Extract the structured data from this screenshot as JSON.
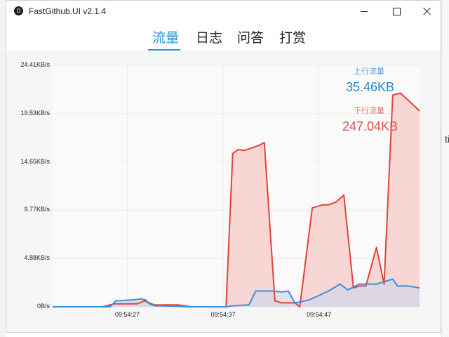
{
  "window": {
    "title": "FastGithub.UI v2.1.4",
    "controls": {
      "minimize": "minimize",
      "maximize": "maximize",
      "close": "close"
    }
  },
  "tabs": [
    {
      "label": "流量",
      "active": true
    },
    {
      "label": "日志",
      "active": false
    },
    {
      "label": "问答",
      "active": false
    },
    {
      "label": "打赏",
      "active": false
    }
  ],
  "background_window": {
    "clipped_text": "ti"
  },
  "legend": {
    "upload_label": "上行流量",
    "upload_value": "35.46KB",
    "download_label": "下行流量",
    "download_value": "247.04KB"
  },
  "colors": {
    "accent": "#2196d3",
    "upload_line": "#3b8fdb",
    "download_line": "#e0443a",
    "download_fill": "#f7cfcb",
    "upload_fill": "#d7d6ea"
  },
  "chart_data": {
    "type": "area",
    "y_ticks": [
      "24.41KB/s",
      "19.53KB/s",
      "14.65KB/s",
      "9.77KB/s",
      "4.88KB/s",
      "0B/s"
    ],
    "y_tick_values": [
      24.41,
      19.53,
      14.65,
      9.77,
      4.88,
      0
    ],
    "ylim": [
      0,
      24.41
    ],
    "x_ticks": [
      "09:54:27",
      "09:54:37",
      "09:54:47"
    ],
    "x_tick_values": [
      27,
      37,
      47
    ],
    "xlim": [
      19.2,
      57.5
    ],
    "grid": true,
    "series": [
      {
        "name": "下行流量",
        "x": [
          19.2,
          24.4,
          25.6,
          28.0,
          28.8,
          29.8,
          32.3,
          33.7,
          35.0,
          36.2,
          37.3,
          38.0,
          38.6,
          39.2,
          40.7,
          41.3,
          42.4,
          43.1,
          44.5,
          45.0,
          46.3,
          47.4,
          48.0,
          48.8,
          49.6,
          50.6,
          51.2,
          51.9,
          53.0,
          53.8,
          54.7,
          55.5,
          56.3,
          57.5
        ],
        "y": [
          0,
          0,
          0.3,
          0.3,
          0.6,
          0.2,
          0.2,
          0,
          0,
          0,
          0,
          15.5,
          15.9,
          15.8,
          16.3,
          16.6,
          0.6,
          0.4,
          0.4,
          0,
          10.0,
          10.3,
          10.3,
          10.6,
          11.3,
          1.9,
          2.1,
          2.1,
          6.0,
          2.3,
          21.4,
          21.6,
          20.9,
          19.8
        ]
      },
      {
        "name": "上行流量",
        "x": [
          19.2,
          24.4,
          25.2,
          25.8,
          27.6,
          28.4,
          28.9,
          29.3,
          29.9,
          30.6,
          33.7,
          35.0,
          37.3,
          38.0,
          39.7,
          40.4,
          42.2,
          43.1,
          43.8,
          44.5,
          46.0,
          48.0,
          49.2,
          50.0,
          51.2,
          53.0,
          54.0,
          54.7,
          55.2,
          56.3,
          57.5
        ],
        "y": [
          0,
          0,
          0,
          0.6,
          0.7,
          0.8,
          0.7,
          0.3,
          0.1,
          0.1,
          0,
          0,
          0,
          0.1,
          0.2,
          1.6,
          1.6,
          1.5,
          1.6,
          0.4,
          0.7,
          1.6,
          2.3,
          1.7,
          2.3,
          2.3,
          2.6,
          2.8,
          2.1,
          2.1,
          1.9
        ]
      }
    ]
  }
}
